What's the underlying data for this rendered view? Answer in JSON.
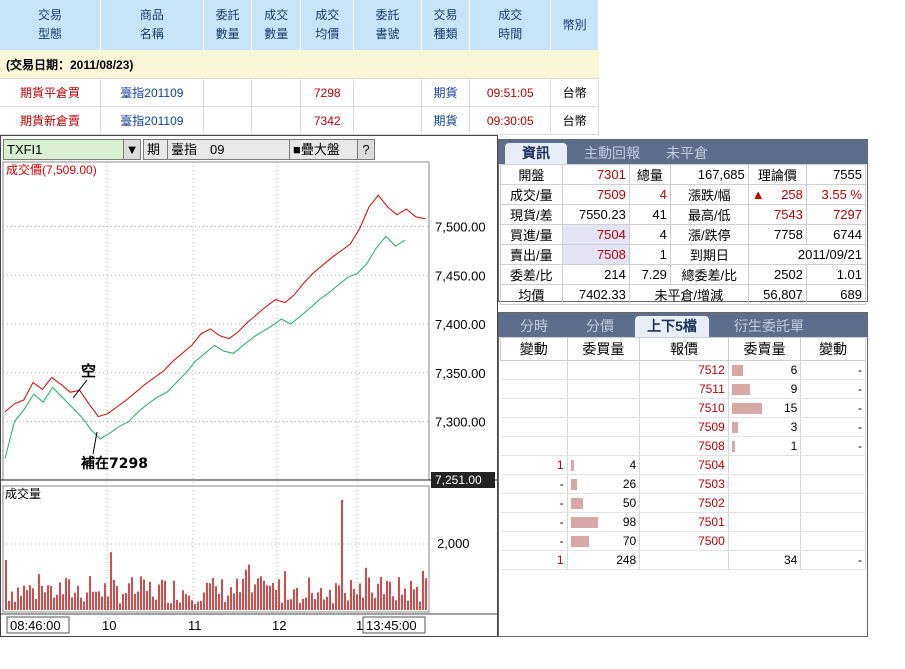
{
  "trade": {
    "headers": [
      "交易\n型態",
      "商品\n名稱",
      "委託\n數量",
      "成交\n數量",
      "成交\n均價",
      "委託\n書號",
      "交易\n種類",
      "成交\n時間",
      "幣別"
    ],
    "date_label": "(交易日期：2011/08/23)",
    "rows": [
      {
        "type": "期貨平倉買",
        "product": "臺指201109",
        "order_qty": "",
        "fill_qty": "",
        "avg_price": "7298",
        "order_no": "",
        "kind": "期貨",
        "time": "09:51:05",
        "currency": "台幣"
      },
      {
        "type": "期貨新倉賣",
        "product": "臺指201109",
        "order_qty": "",
        "fill_qty": "",
        "avg_price": "7342",
        "order_no": "",
        "kind": "期貨",
        "time": "09:30:05",
        "currency": "台幣"
      }
    ]
  },
  "toolbar": {
    "symbol": "TXFI1",
    "dropdown": "▼",
    "period": "期",
    "name": "臺指　09",
    "overlay": "疊大盤",
    "help": "?"
  },
  "chart": {
    "price_label": "成交價(7,509.00)",
    "volume_label": "成交量",
    "annotation_short": "空",
    "annotation_cover": "補在7298",
    "current_price_tag": "7,251.00",
    "time_labels": [
      "08:46:00",
      "10",
      "11",
      "12",
      "1",
      "13:45:00"
    ],
    "colors": {
      "price": "#e00000",
      "index": "#20b060",
      "volume": "#c00000",
      "grid": "#b0b0b0"
    }
  },
  "chart_data": {
    "type": "line",
    "xlabel": "",
    "ylabel": "",
    "ylim": [
      7240,
      7560
    ],
    "yticks": [
      "7,500.00",
      "7,450.00",
      "7,400.00",
      "7,350.00",
      "7,300.00"
    ],
    "series": [
      {
        "name": "成交價",
        "values": [
          7310,
          7318,
          7322,
          7340,
          7333,
          7345,
          7338,
          7330,
          7332,
          7318,
          7305,
          7308,
          7315,
          7322,
          7330,
          7338,
          7345,
          7352,
          7362,
          7370,
          7378,
          7390,
          7395,
          7388,
          7385,
          7392,
          7402,
          7410,
          7418,
          7425,
          7422,
          7430,
          7442,
          7452,
          7460,
          7468,
          7475,
          7482,
          7498,
          7520,
          7532,
          7520,
          7512,
          7518,
          7510,
          7508
        ]
      },
      {
        "name": "",
        "values": [
          7262,
          7300,
          7312,
          7328,
          7320,
          7335,
          7325,
          7315,
          7305,
          7292,
          7282,
          7288,
          7295,
          7300,
          7310,
          7318,
          7325,
          7330,
          7340,
          7350,
          7362,
          7370,
          7378,
          7372,
          7370,
          7378,
          7386,
          7392,
          7398,
          7405,
          7400,
          7408,
          7416,
          7425,
          7432,
          7440,
          7448,
          7452,
          7462,
          7478,
          7490,
          7480,
          7486
        ]
      }
    ],
    "volume_ticks": [
      "2,000"
    ]
  },
  "quote": {
    "tabs": [
      "資訊",
      "主動回報",
      "未平倉"
    ],
    "rows": [
      [
        "開盤",
        "7301",
        "總量",
        "167,685",
        "理論價",
        "7555",
        ""
      ],
      [
        "成交/量",
        "7509",
        "4",
        "漲跌/幅",
        "▲",
        "258",
        "3.55 %"
      ],
      [
        "現貨/差",
        "7550.23",
        "41",
        "最高/低",
        "7543",
        "7297",
        ""
      ],
      [
        "買進/量",
        "7504",
        "4",
        "漲/跌停",
        "7758",
        "6744",
        ""
      ],
      [
        "賣出/量",
        "7508",
        "1",
        "到期日",
        "2011/09/21",
        "",
        ""
      ],
      [
        "委差/比",
        "214",
        "7.29",
        "總委差/比",
        "2502",
        "1.01",
        ""
      ],
      [
        "均價",
        "7402.33",
        "未平倉/增減",
        "56,807",
        "689",
        "",
        ""
      ]
    ]
  },
  "book": {
    "tabs": [
      "分時",
      "分價",
      "上下5檔",
      "衍生委託單"
    ],
    "headers": [
      "變動",
      "委買量",
      "報價",
      "委賣量",
      "變動"
    ],
    "asks": [
      {
        "price": "7512",
        "qty": "6",
        "chg": "-",
        "bar": 0.18
      },
      {
        "price": "7511",
        "qty": "9",
        "chg": "-",
        "bar": 0.3
      },
      {
        "price": "7510",
        "qty": "15",
        "chg": "-",
        "bar": 0.5
      },
      {
        "price": "7509",
        "qty": "3",
        "chg": "-",
        "bar": 0.1
      },
      {
        "price": "7508",
        "qty": "1",
        "chg": "-",
        "bar": 0.05
      }
    ],
    "bids": [
      {
        "price": "7504",
        "qty": "4",
        "chg": "1",
        "bar": 0.05
      },
      {
        "price": "7503",
        "qty": "26",
        "chg": "-",
        "bar": 0.1
      },
      {
        "price": "7502",
        "qty": "50",
        "chg": "-",
        "bar": 0.2
      },
      {
        "price": "7501",
        "qty": "98",
        "chg": "-",
        "bar": 0.45
      },
      {
        "price": "7500",
        "qty": "70",
        "chg": "-",
        "bar": 0.3
      }
    ],
    "total": {
      "bid_chg": "1",
      "bid_qty": "248",
      "ask_qty": "34",
      "ask_chg": "-"
    }
  }
}
